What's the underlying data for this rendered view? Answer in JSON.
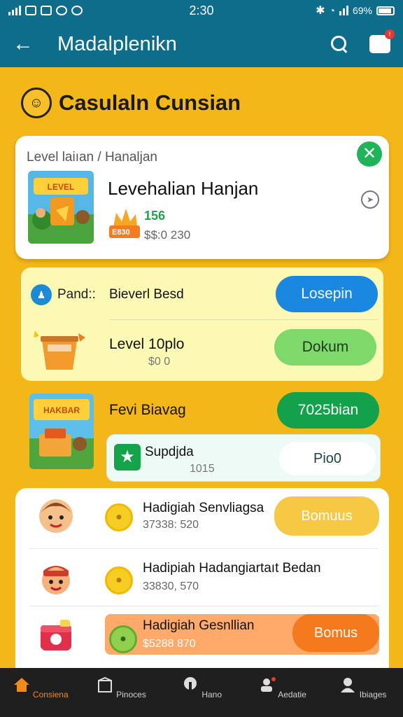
{
  "status": {
    "time": "2:30",
    "battery": "69%"
  },
  "appbar": {
    "title": "Madalplenikn"
  },
  "section": {
    "title": "Casulaln Cunsian"
  },
  "card1": {
    "crumb": "Level laiıan / Hanaljan",
    "title": "Levehalian Hanjan",
    "price": "156",
    "badge": "E830",
    "sub": "$$:0 230"
  },
  "panel": {
    "label": "Pand::",
    "label2": "Bieverl Besd",
    "button1": "Losepin",
    "title": "Level 10plo",
    "sub": "$0 0",
    "button2": "Dokum"
  },
  "row3": {
    "title": "Fevi Biavag",
    "button": "7025bian",
    "sub_title": "Supdjda",
    "sub_value": "1015",
    "sub_button": "Pio0"
  },
  "list": [
    {
      "title": "Hadigiah Senvliagsa",
      "sub": "37338: 520",
      "button": "Bomuus"
    },
    {
      "title": "Hadipiah Hadangiartaıt Bedan",
      "sub": "33830, 570"
    },
    {
      "title": "Hadigiah Gesnllian",
      "sub": "$5288 870",
      "button": "Bomus"
    }
  ],
  "nav": [
    {
      "label": "Consiena",
      "icon": "home-icon"
    },
    {
      "label": "Pinoces",
      "icon": "box-icon"
    },
    {
      "label": "Hano",
      "icon": "lock-icon"
    },
    {
      "label": "Aedatie",
      "icon": "user-alert-icon"
    },
    {
      "label": "Ibiages",
      "icon": "profile-icon"
    }
  ],
  "colors": {
    "primary": "#0f6d8c",
    "background": "#f4b71a",
    "blue_button": "#1a87e0",
    "green_button": "#13a24b",
    "light_green_button": "#7ed86a",
    "yellow_button": "#f7c843",
    "orange_button": "#f57a1d",
    "nav_active": "#f0891e"
  }
}
